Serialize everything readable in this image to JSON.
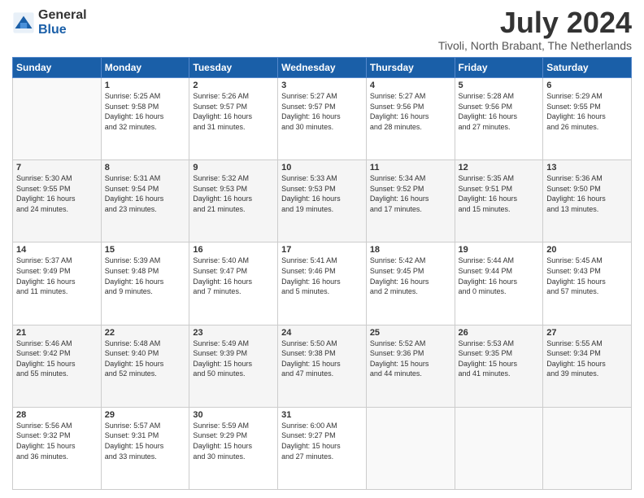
{
  "logo": {
    "general": "General",
    "blue": "Blue"
  },
  "title": {
    "month_year": "July 2024",
    "location": "Tivoli, North Brabant, The Netherlands"
  },
  "weekdays": [
    "Sunday",
    "Monday",
    "Tuesday",
    "Wednesday",
    "Thursday",
    "Friday",
    "Saturday"
  ],
  "weeks": [
    [
      {
        "day": "",
        "info": ""
      },
      {
        "day": "1",
        "info": "Sunrise: 5:25 AM\nSunset: 9:58 PM\nDaylight: 16 hours\nand 32 minutes."
      },
      {
        "day": "2",
        "info": "Sunrise: 5:26 AM\nSunset: 9:57 PM\nDaylight: 16 hours\nand 31 minutes."
      },
      {
        "day": "3",
        "info": "Sunrise: 5:27 AM\nSunset: 9:57 PM\nDaylight: 16 hours\nand 30 minutes."
      },
      {
        "day": "4",
        "info": "Sunrise: 5:27 AM\nSunset: 9:56 PM\nDaylight: 16 hours\nand 28 minutes."
      },
      {
        "day": "5",
        "info": "Sunrise: 5:28 AM\nSunset: 9:56 PM\nDaylight: 16 hours\nand 27 minutes."
      },
      {
        "day": "6",
        "info": "Sunrise: 5:29 AM\nSunset: 9:55 PM\nDaylight: 16 hours\nand 26 minutes."
      }
    ],
    [
      {
        "day": "7",
        "info": "Sunrise: 5:30 AM\nSunset: 9:55 PM\nDaylight: 16 hours\nand 24 minutes."
      },
      {
        "day": "8",
        "info": "Sunrise: 5:31 AM\nSunset: 9:54 PM\nDaylight: 16 hours\nand 23 minutes."
      },
      {
        "day": "9",
        "info": "Sunrise: 5:32 AM\nSunset: 9:53 PM\nDaylight: 16 hours\nand 21 minutes."
      },
      {
        "day": "10",
        "info": "Sunrise: 5:33 AM\nSunset: 9:53 PM\nDaylight: 16 hours\nand 19 minutes."
      },
      {
        "day": "11",
        "info": "Sunrise: 5:34 AM\nSunset: 9:52 PM\nDaylight: 16 hours\nand 17 minutes."
      },
      {
        "day": "12",
        "info": "Sunrise: 5:35 AM\nSunset: 9:51 PM\nDaylight: 16 hours\nand 15 minutes."
      },
      {
        "day": "13",
        "info": "Sunrise: 5:36 AM\nSunset: 9:50 PM\nDaylight: 16 hours\nand 13 minutes."
      }
    ],
    [
      {
        "day": "14",
        "info": "Sunrise: 5:37 AM\nSunset: 9:49 PM\nDaylight: 16 hours\nand 11 minutes."
      },
      {
        "day": "15",
        "info": "Sunrise: 5:39 AM\nSunset: 9:48 PM\nDaylight: 16 hours\nand 9 minutes."
      },
      {
        "day": "16",
        "info": "Sunrise: 5:40 AM\nSunset: 9:47 PM\nDaylight: 16 hours\nand 7 minutes."
      },
      {
        "day": "17",
        "info": "Sunrise: 5:41 AM\nSunset: 9:46 PM\nDaylight: 16 hours\nand 5 minutes."
      },
      {
        "day": "18",
        "info": "Sunrise: 5:42 AM\nSunset: 9:45 PM\nDaylight: 16 hours\nand 2 minutes."
      },
      {
        "day": "19",
        "info": "Sunrise: 5:44 AM\nSunset: 9:44 PM\nDaylight: 16 hours\nand 0 minutes."
      },
      {
        "day": "20",
        "info": "Sunrise: 5:45 AM\nSunset: 9:43 PM\nDaylight: 15 hours\nand 57 minutes."
      }
    ],
    [
      {
        "day": "21",
        "info": "Sunrise: 5:46 AM\nSunset: 9:42 PM\nDaylight: 15 hours\nand 55 minutes."
      },
      {
        "day": "22",
        "info": "Sunrise: 5:48 AM\nSunset: 9:40 PM\nDaylight: 15 hours\nand 52 minutes."
      },
      {
        "day": "23",
        "info": "Sunrise: 5:49 AM\nSunset: 9:39 PM\nDaylight: 15 hours\nand 50 minutes."
      },
      {
        "day": "24",
        "info": "Sunrise: 5:50 AM\nSunset: 9:38 PM\nDaylight: 15 hours\nand 47 minutes."
      },
      {
        "day": "25",
        "info": "Sunrise: 5:52 AM\nSunset: 9:36 PM\nDaylight: 15 hours\nand 44 minutes."
      },
      {
        "day": "26",
        "info": "Sunrise: 5:53 AM\nSunset: 9:35 PM\nDaylight: 15 hours\nand 41 minutes."
      },
      {
        "day": "27",
        "info": "Sunrise: 5:55 AM\nSunset: 9:34 PM\nDaylight: 15 hours\nand 39 minutes."
      }
    ],
    [
      {
        "day": "28",
        "info": "Sunrise: 5:56 AM\nSunset: 9:32 PM\nDaylight: 15 hours\nand 36 minutes."
      },
      {
        "day": "29",
        "info": "Sunrise: 5:57 AM\nSunset: 9:31 PM\nDaylight: 15 hours\nand 33 minutes."
      },
      {
        "day": "30",
        "info": "Sunrise: 5:59 AM\nSunset: 9:29 PM\nDaylight: 15 hours\nand 30 minutes."
      },
      {
        "day": "31",
        "info": "Sunrise: 6:00 AM\nSunset: 9:27 PM\nDaylight: 15 hours\nand 27 minutes."
      },
      {
        "day": "",
        "info": ""
      },
      {
        "day": "",
        "info": ""
      },
      {
        "day": "",
        "info": ""
      }
    ]
  ]
}
